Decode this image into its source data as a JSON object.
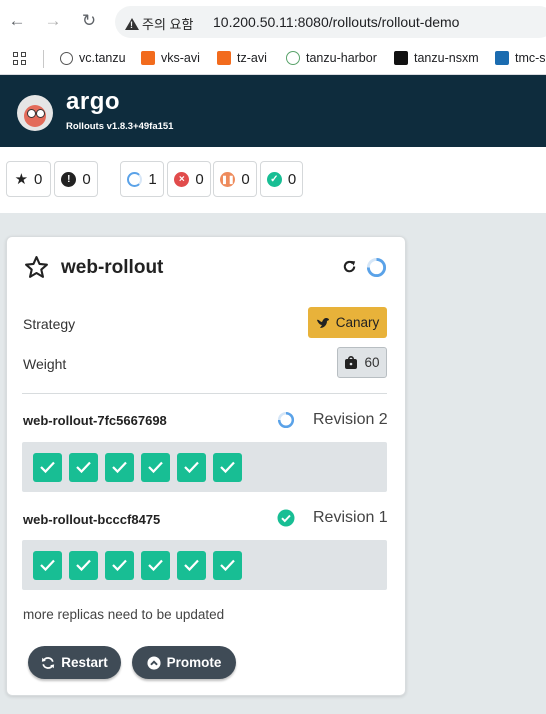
{
  "browser": {
    "warning_label": "주의 요함",
    "url": "10.200.50.11:8080/rollouts/rollout-demo",
    "bookmarks": [
      {
        "label": "vc.tanzu"
      },
      {
        "label": "vks-avi"
      },
      {
        "label": "tz-avi"
      },
      {
        "label": "tanzu-harbor"
      },
      {
        "label": "tanzu-nsxm"
      },
      {
        "label": "tmc-s"
      }
    ]
  },
  "header": {
    "logo_text": "argo",
    "version": "Rollouts v1.8.3+49fa151"
  },
  "filters": {
    "favorites_count": "0",
    "error_count": "0",
    "progressing_count": "1",
    "degraded_count": "0",
    "paused_count": "0",
    "healthy_count": "0"
  },
  "rollout": {
    "name": "web-rollout",
    "strategy_label": "Strategy",
    "strategy_value": "Canary",
    "weight_label": "Weight",
    "weight_value": "60",
    "replicasets": [
      {
        "name": "web-rollout-7fc5667698",
        "revision": "Revision 2",
        "status": "progressing",
        "pods": 6
      },
      {
        "name": "web-rollout-bcccf8475",
        "revision": "Revision 1",
        "status": "healthy",
        "pods": 6
      }
    ],
    "message": "more replicas need to be updated",
    "restart_label": "Restart",
    "promote_label": "Promote"
  },
  "colors": {
    "header_bg": "#0e2c3d",
    "canary": "#e8b23a",
    "pod_ok": "#18be94",
    "progress_blue": "#5aa2e8",
    "error_red": "#e14c4c",
    "paused_orange": "#ee8b5c",
    "healthy_green": "#18be94"
  }
}
